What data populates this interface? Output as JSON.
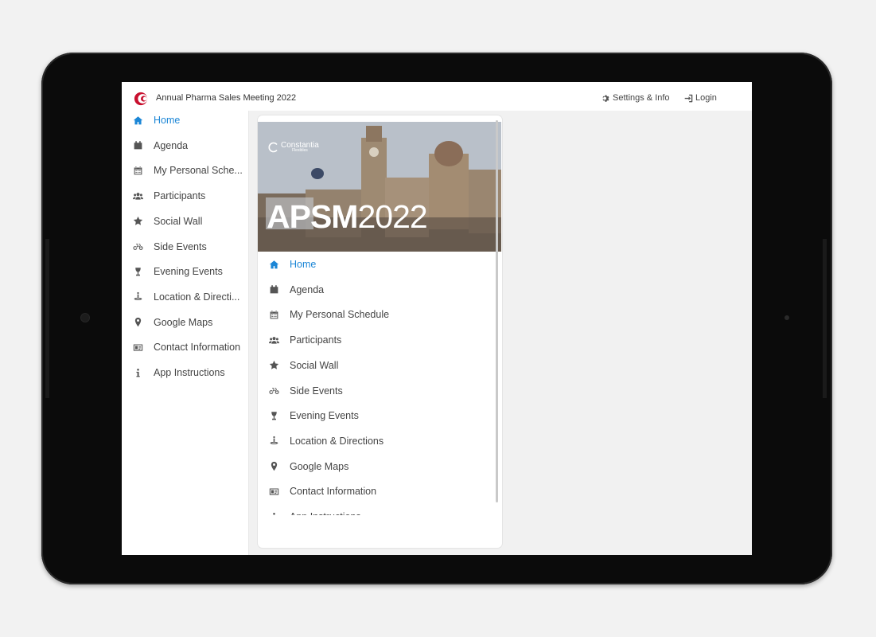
{
  "header": {
    "app_title": "Annual Pharma Sales Meeting 2022",
    "settings_label": "Settings & Info",
    "login_label": "Login"
  },
  "colors": {
    "accent": "#1b86d6",
    "logo_red": "#c8102e"
  },
  "sidebar": {
    "items": [
      {
        "label": "Home",
        "icon": "home-icon",
        "active": true
      },
      {
        "label": "Agenda",
        "icon": "calendar-icon"
      },
      {
        "label": "My Personal Sche...",
        "icon": "schedule-icon"
      },
      {
        "label": "Participants",
        "icon": "users-icon"
      },
      {
        "label": "Social Wall",
        "icon": "star-icon"
      },
      {
        "label": "Side Events",
        "icon": "bicycle-icon"
      },
      {
        "label": "Evening Events",
        "icon": "glass-icon"
      },
      {
        "label": "Location & Directi...",
        "icon": "location-icon"
      },
      {
        "label": "Google Maps",
        "icon": "map-pin-icon"
      },
      {
        "label": "Contact Information",
        "icon": "contact-card-icon"
      },
      {
        "label": "App Instructions",
        "icon": "info-icon"
      }
    ]
  },
  "card": {
    "brand": "Constantia",
    "brand_sub": "Flexibles",
    "banner_bold": "APSM",
    "banner_year": "2022",
    "items": [
      {
        "label": "Home",
        "icon": "home-icon",
        "active": true
      },
      {
        "label": "Agenda",
        "icon": "calendar-icon"
      },
      {
        "label": "My Personal Schedule",
        "icon": "schedule-icon"
      },
      {
        "label": "Participants",
        "icon": "users-icon"
      },
      {
        "label": "Social Wall",
        "icon": "star-icon"
      },
      {
        "label": "Side Events",
        "icon": "bicycle-icon"
      },
      {
        "label": "Evening Events",
        "icon": "glass-icon"
      },
      {
        "label": "Location & Directions",
        "icon": "location-icon"
      },
      {
        "label": "Google Maps",
        "icon": "map-pin-icon"
      },
      {
        "label": "Contact Information",
        "icon": "contact-card-icon"
      },
      {
        "label": "App Instructions",
        "icon": "info-icon"
      }
    ]
  }
}
